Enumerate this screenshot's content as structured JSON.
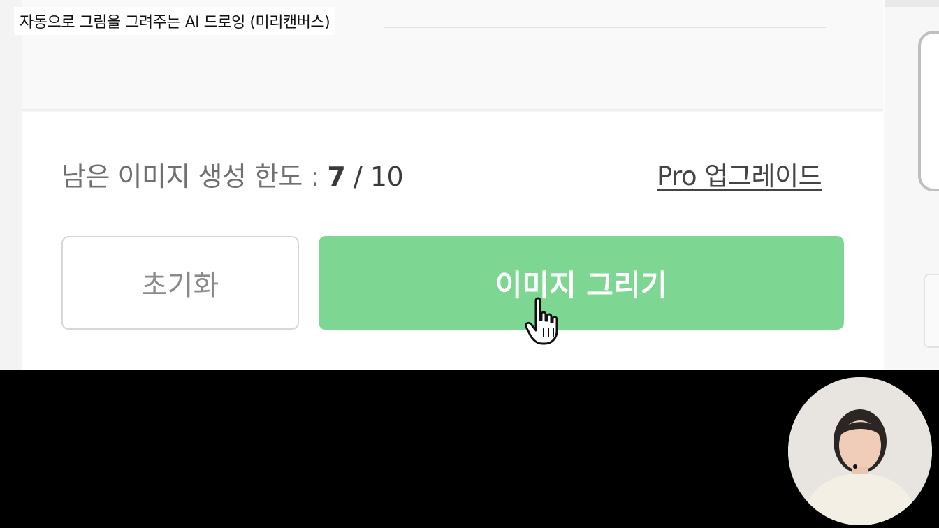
{
  "caption": "자동으로 그림을 그려주는 AI 드로잉 (미리캔버스)",
  "quota": {
    "label": "남은 이미지 생성 한도 :",
    "used": "7",
    "separator": "/",
    "total": "10"
  },
  "pro_link": "Pro 업그레이드",
  "buttons": {
    "reset": "초기화",
    "draw": "이미지 그리기"
  },
  "colors": {
    "draw_button": "#7dd691",
    "background": "#ffffff",
    "video_bar": "#000000"
  },
  "cursor_icon": "pointer-hand-icon"
}
